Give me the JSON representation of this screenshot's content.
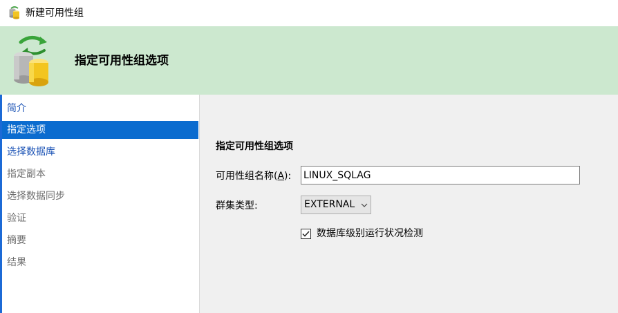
{
  "window": {
    "title": "新建可用性组",
    "app_icon": "availability-group-icon"
  },
  "header": {
    "heading": "指定可用性组选项",
    "icon": "database-sync-icon",
    "background": "#cce8cf"
  },
  "sidebar": {
    "items": [
      {
        "label": "简介",
        "state": "link"
      },
      {
        "label": "指定选项",
        "state": "active"
      },
      {
        "label": "选择数据库",
        "state": "link"
      },
      {
        "label": "指定副本",
        "state": "disabled"
      },
      {
        "label": "选择数据同步",
        "state": "disabled"
      },
      {
        "label": "验证",
        "state": "disabled"
      },
      {
        "label": "摘要",
        "state": "disabled"
      },
      {
        "label": "结果",
        "state": "disabled"
      }
    ],
    "active_color": "#0b6ccf",
    "link_color": "#1a52b5"
  },
  "main": {
    "section_title": "指定可用性组选项",
    "name_label_prefix": "可用性组名称(",
    "name_label_accel": "A",
    "name_label_suffix": "):",
    "name_value": "LINUX_SQLAG",
    "cluster_label": "群集类型:",
    "cluster_value": "EXTERNAL",
    "health_check_label": "数据库级别运行状况检测",
    "health_check_checked": true
  }
}
